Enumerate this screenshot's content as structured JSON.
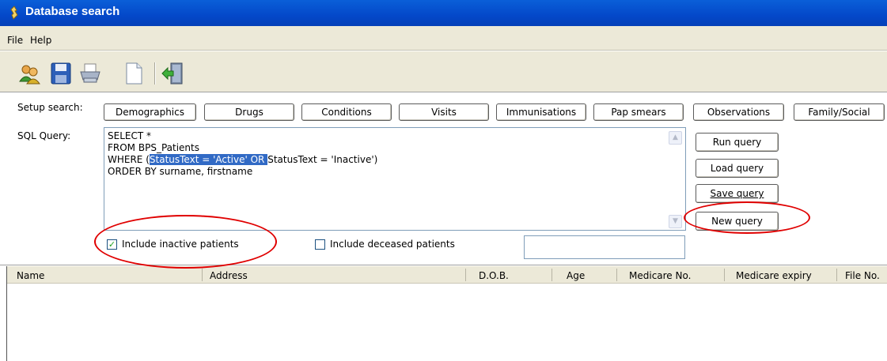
{
  "window": {
    "title": "Database search"
  },
  "menu": {
    "items": [
      "File",
      "Help"
    ]
  },
  "toolbar": {
    "icons": [
      "users-icon",
      "save-icon",
      "print-icon",
      "new-document-icon",
      "exit-icon"
    ]
  },
  "setup": {
    "label": "Setup search:",
    "buttons": [
      "Demographics",
      "Drugs",
      "Conditions",
      "Visits",
      "Immunisations",
      "Pap smears",
      "Observations",
      "Family/Social"
    ]
  },
  "sql": {
    "label": "SQL Query:",
    "line1": "SELECT *",
    "line2": "FROM BPS_Patients",
    "line3_prefix": "WHERE (",
    "line3_selected": "StatusText = 'Active' OR ",
    "line3_suffix": "StatusText = 'Inactive')",
    "line4": "ORDER BY surname, firstname"
  },
  "actions": {
    "run": "Run query",
    "load": "Load query",
    "save": "Save query",
    "new": "New query"
  },
  "options": {
    "include_inactive": {
      "label": "Include inactive patients",
      "checked": true
    },
    "include_deceased": {
      "label": "Include deceased patients",
      "checked": false
    }
  },
  "results": {
    "columns": [
      "Name",
      "Address",
      "D.O.B.",
      "Age",
      "Medicare No.",
      "Medicare expiry",
      "File No."
    ],
    "rows": []
  },
  "colors": {
    "annotation": "#e00000",
    "selection": "#316ac5",
    "titlebar": "#0448c9"
  }
}
